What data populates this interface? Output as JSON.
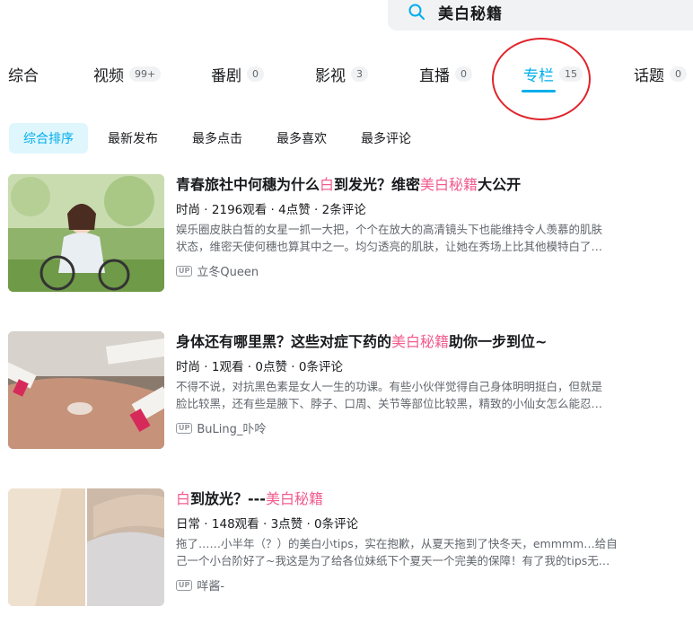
{
  "search": {
    "query": "美白秘籍"
  },
  "tabs": [
    {
      "label": "综合",
      "count": ""
    },
    {
      "label": "视频",
      "count": "99+"
    },
    {
      "label": "番剧",
      "count": "0"
    },
    {
      "label": "影视",
      "count": "3"
    },
    {
      "label": "直播",
      "count": "0"
    },
    {
      "label": "专栏",
      "count": "15"
    },
    {
      "label": "话题",
      "count": "0"
    }
  ],
  "sort": [
    "综合排序",
    "最新发布",
    "最多点击",
    "最多喜欢",
    "最多评论"
  ],
  "articles": [
    {
      "title_parts": [
        "青春旅社中何穗为什么",
        "白",
        "到发光？维密",
        "美白秘籍",
        "大公开"
      ],
      "category": "时尚",
      "views": "2196观看",
      "likes": "4点赞",
      "comments": "2条评论",
      "desc_line1": "娱乐圈皮肤白皙的女星一抓一大把，个个在放大的高清镜头下也能维持令人羡慕的肌肤",
      "desc_line2": "状态，维密天使何穗也算其中之一。均匀透亮的肌肤，让她在秀场上比其他模特白了…",
      "author": "立冬Queen"
    },
    {
      "title_parts": [
        "身体还有哪里黑？这些对症下药的",
        "美白秘籍",
        "助你一步到位~",
        "",
        ""
      ],
      "category": "时尚",
      "views": "1观看",
      "likes": "0点赞",
      "comments": "0条评论",
      "desc_line1": "不得不说，对抗黑色素是女人一生的功课。有些小伙伴觉得自己身体明明挺白，但就是",
      "desc_line2": "脸比较黑，还有些是腋下、脖子、口周、关节等部位比较黑，精致的小仙女怎么能忍…",
      "author": "BuLing_卟呤"
    },
    {
      "title_parts": [
        "",
        "白",
        "到放光？---",
        "美白秘籍",
        ""
      ],
      "category": "日常",
      "views": "148观看",
      "likes": "3点赞",
      "comments": "0条评论",
      "desc_line1": "拖了……小半年（？）的美白小tips，实在抱歉，从夏天拖到了快冬天，emmmm…给自",
      "desc_line2": "己一个小台阶好了~我这是为了给各位妹纸下个夏天一个完美的保障！有了我的tips无…",
      "author": "咩酱-"
    }
  ],
  "meta_sep": "·",
  "up_label": "UP",
  "colors": {
    "accent": "#00aeec",
    "highlight": "#f25d8e",
    "annotation": "#e0242c"
  }
}
